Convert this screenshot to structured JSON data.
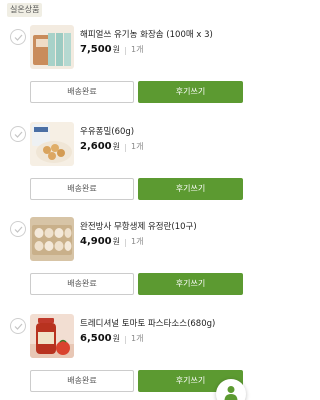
{
  "section": {
    "label": "실온상품"
  },
  "items": [
    {
      "name": "해피얼쓰 유기농 화장솜 (100매 x 3)",
      "price": "7,500",
      "currency": "원",
      "quantity": "1개",
      "ship_label": "배송완료",
      "review_label": "후기쓰기"
    },
    {
      "name": "우유퐁밀(60g)",
      "price": "2,600",
      "currency": "원",
      "quantity": "1개",
      "ship_label": "배송완료",
      "review_label": "후기쓰기"
    },
    {
      "name": "완전방사 무항생제 유정란(10구)",
      "price": "4,900",
      "currency": "원",
      "quantity": "1개",
      "ship_label": "배송완료",
      "review_label": "후기쓰기"
    },
    {
      "name": "트레디셔널 토마토 파스타소스(680g)",
      "price": "6,500",
      "currency": "원",
      "quantity": "1개",
      "ship_label": "배송완료",
      "review_label": "후기쓰기"
    }
  ],
  "colors": {
    "accent": "#5c9a31",
    "check_border": "#cfcfcf",
    "label_bg": "#f0eee4"
  },
  "icons": {
    "check": "check-icon",
    "fab": "user-icon"
  }
}
